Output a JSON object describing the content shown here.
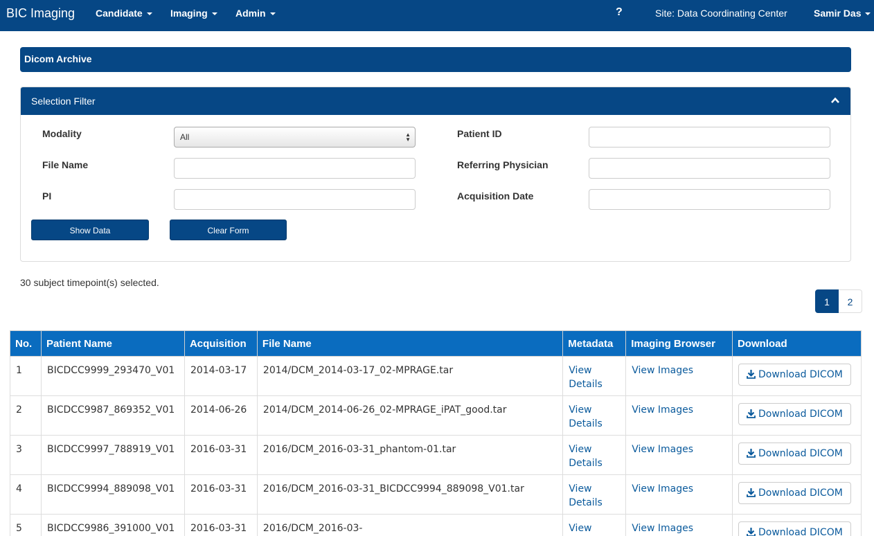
{
  "nav": {
    "brand": "BIC Imaging",
    "menus": [
      "Candidate",
      "Imaging",
      "Admin"
    ],
    "help": "?",
    "site": "Site: Data Coordinating Center",
    "user": "Samir Das"
  },
  "panel_title": "Dicom Archive",
  "filter": {
    "title": "Selection Filter",
    "modality_label": "Modality",
    "modality_value": "All",
    "patient_id_label": "Patient ID",
    "file_name_label": "File Name",
    "referring_physician_label": "Referring Physician",
    "pi_label": "PI",
    "acquisition_date_label": "Acquisition Date",
    "show_data": "Show Data",
    "clear_form": "Clear Form"
  },
  "count_text": "30 subject timepoint(s) selected.",
  "pagination": [
    "1",
    "2"
  ],
  "table": {
    "headers": [
      "No.",
      "Patient Name",
      "Acquisition",
      "File Name",
      "Metadata",
      "Imaging Browser",
      "Download"
    ],
    "rows": [
      {
        "no": "1",
        "patient": "BICDCC9999_293470_V01",
        "acq": "2014-03-17",
        "file": "2014/DCM_2014-03-17_02-MPRAGE.tar",
        "meta1": "View",
        "meta2": "Details",
        "browser": "View Images",
        "download": "Download DICOM"
      },
      {
        "no": "2",
        "patient": "BICDCC9987_869352_V01",
        "acq": "2014-06-26",
        "file": "2014/DCM_2014-06-26_02-MPRAGE_iPAT_good.tar",
        "meta1": "View",
        "meta2": "Details",
        "browser": "View Images",
        "download": "Download DICOM"
      },
      {
        "no": "3",
        "patient": "BICDCC9997_788919_V01",
        "acq": "2016-03-31",
        "file": "2016/DCM_2016-03-31_phantom-01.tar",
        "meta1": "View",
        "meta2": "Details",
        "browser": "View Images",
        "download": "Download DICOM"
      },
      {
        "no": "4",
        "patient": "BICDCC9994_889098_V01",
        "acq": "2016-03-31",
        "file": "2016/DCM_2016-03-31_BICDCC9994_889098_V01.tar",
        "meta1": "View",
        "meta2": "Details",
        "browser": "View Images",
        "download": "Download DICOM"
      },
      {
        "no": "5",
        "patient": "BICDCC9986_391000_V01",
        "acq": "2016-03-31",
        "file": "2016/DCM_2016-03-",
        "meta1": "View",
        "meta2": "",
        "browser": "View Images",
        "download": "Download DICOM"
      }
    ]
  },
  "colors": {
    "brand": "#064785",
    "table_header": "#0a6cbf",
    "link": "#0a5a9c"
  }
}
